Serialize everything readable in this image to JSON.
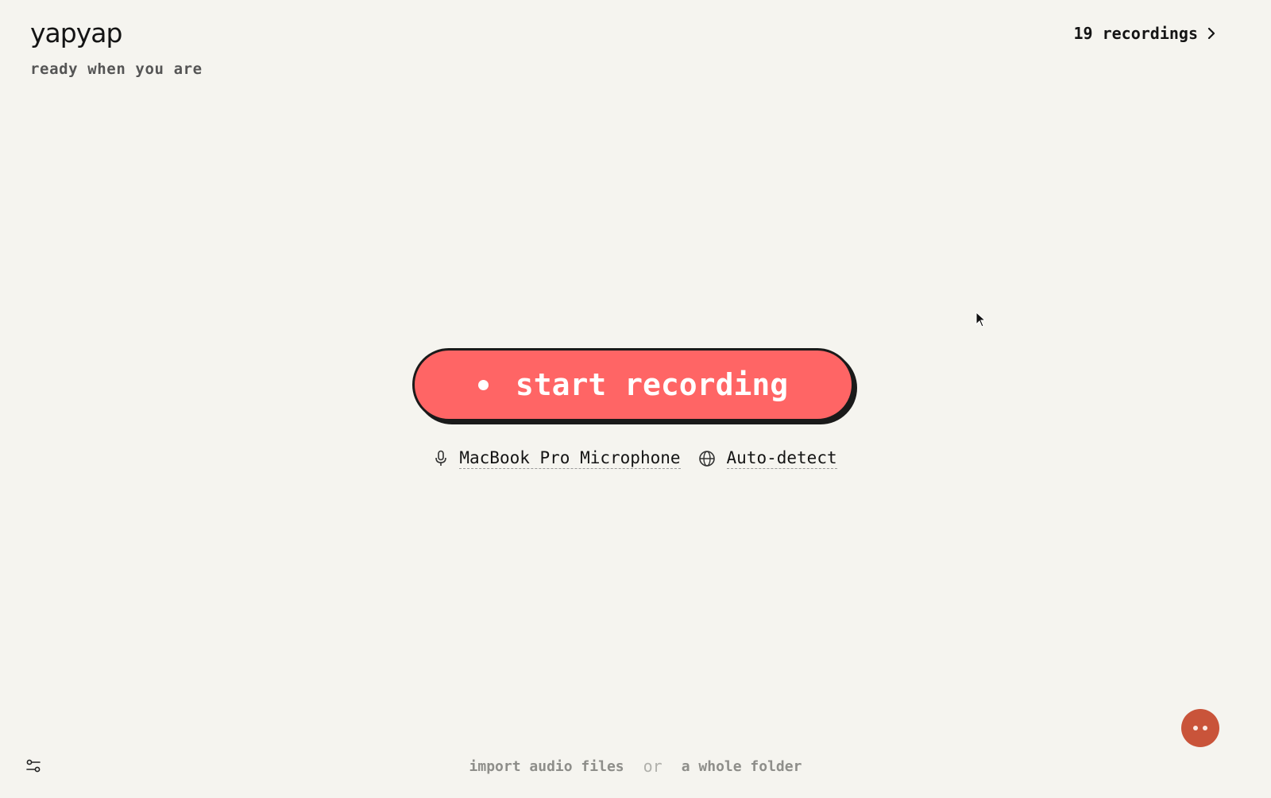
{
  "header": {
    "logo": "yapyap",
    "tagline": "ready when you are",
    "recordings_link": "19 recordings"
  },
  "main": {
    "record_button_label": "start recording",
    "microphone": "MacBook Pro Microphone",
    "language": "Auto-detect"
  },
  "footer": {
    "import_files": "import audio files",
    "separator": "or",
    "import_folder": "a whole folder"
  },
  "icons": {
    "record": "record-dot-icon",
    "microphone": "microphone-icon",
    "language": "globe-icon",
    "recordings": "chevron-right-icon",
    "settings": "sliders-icon",
    "assistant": "avatar-face-icon"
  },
  "colors": {
    "background": "#f5f4ef",
    "record_button": "#ff6565",
    "record_button_border": "#1a1a1a",
    "avatar": "#c9543a",
    "muted_text": "#8e8e8a"
  }
}
